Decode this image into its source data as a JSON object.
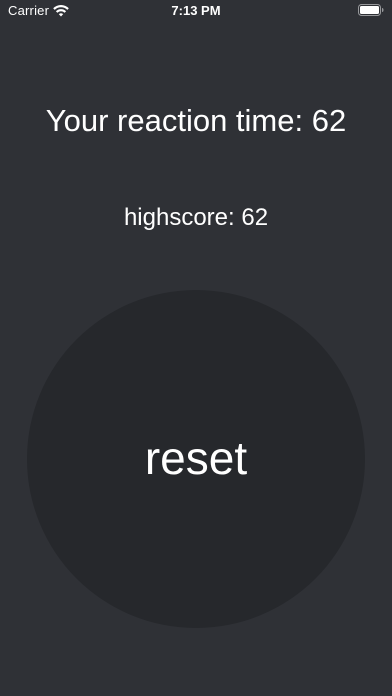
{
  "status_bar": {
    "carrier": "Carrier",
    "time": "7:13 PM",
    "wifi_icon": "wifi-icon",
    "battery_icon": "battery-icon"
  },
  "main": {
    "reaction_text": "Your reaction time: 62",
    "highscore_text": "highscore: 62",
    "reset_label": "reset"
  },
  "colors": {
    "background": "#2f3136",
    "button": "#26282c",
    "text": "#ffffff"
  }
}
